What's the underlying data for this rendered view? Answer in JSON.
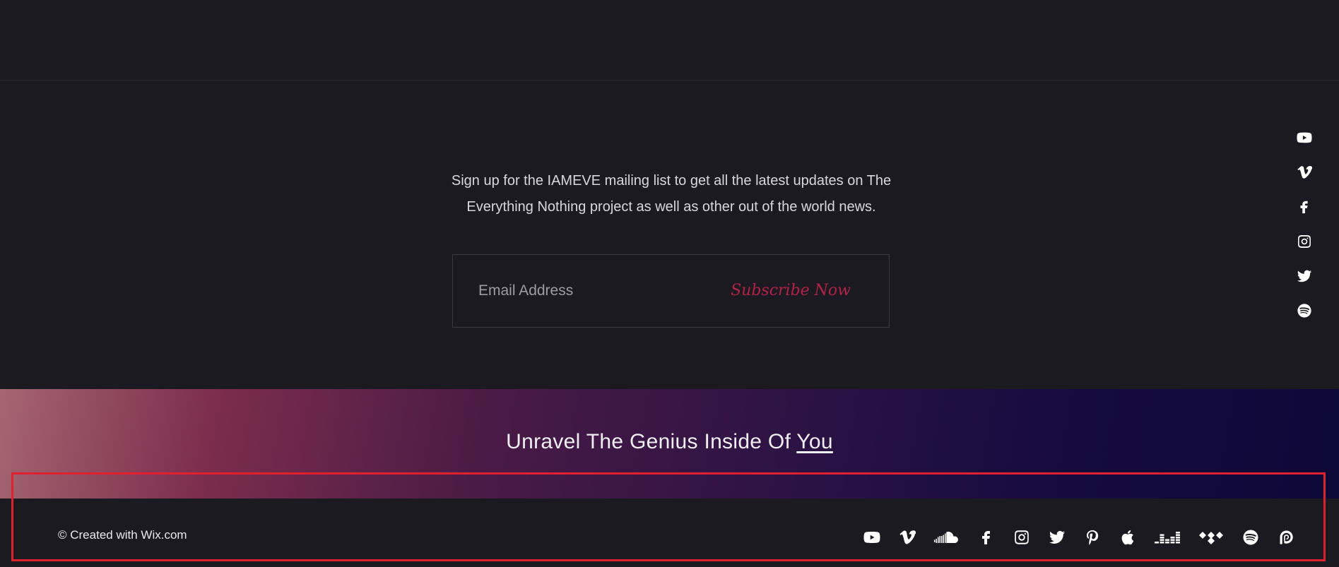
{
  "newsletter": {
    "description_line1": "Sign up for the IAMEVE mailing list to get all the latest updates on The",
    "description_line2": "Everything Nothing project as well as other out of the world news.",
    "email_placeholder": "Email Address",
    "subscribe_label": "Subscribe Now"
  },
  "side_social": [
    "youtube-icon",
    "vimeo-icon",
    "facebook-icon",
    "instagram-icon",
    "twitter-icon",
    "spotify-icon"
  ],
  "banner": {
    "tagline_text": "Unravel The Genius Inside Of ",
    "tagline_link": "You"
  },
  "footer": {
    "copyright": "© Created with Wix.com",
    "social": [
      "youtube-icon",
      "vimeo-icon",
      "soundcloud-icon",
      "facebook-icon",
      "instagram-icon",
      "twitter-icon",
      "pinterest-icon",
      "apple-icon",
      "deezer-icon",
      "tidal-icon",
      "spotify-icon",
      "patreon-icon"
    ]
  },
  "colors": {
    "background": "#1b1a20",
    "accent": "#b22148",
    "highlight_border": "#e0202e"
  }
}
